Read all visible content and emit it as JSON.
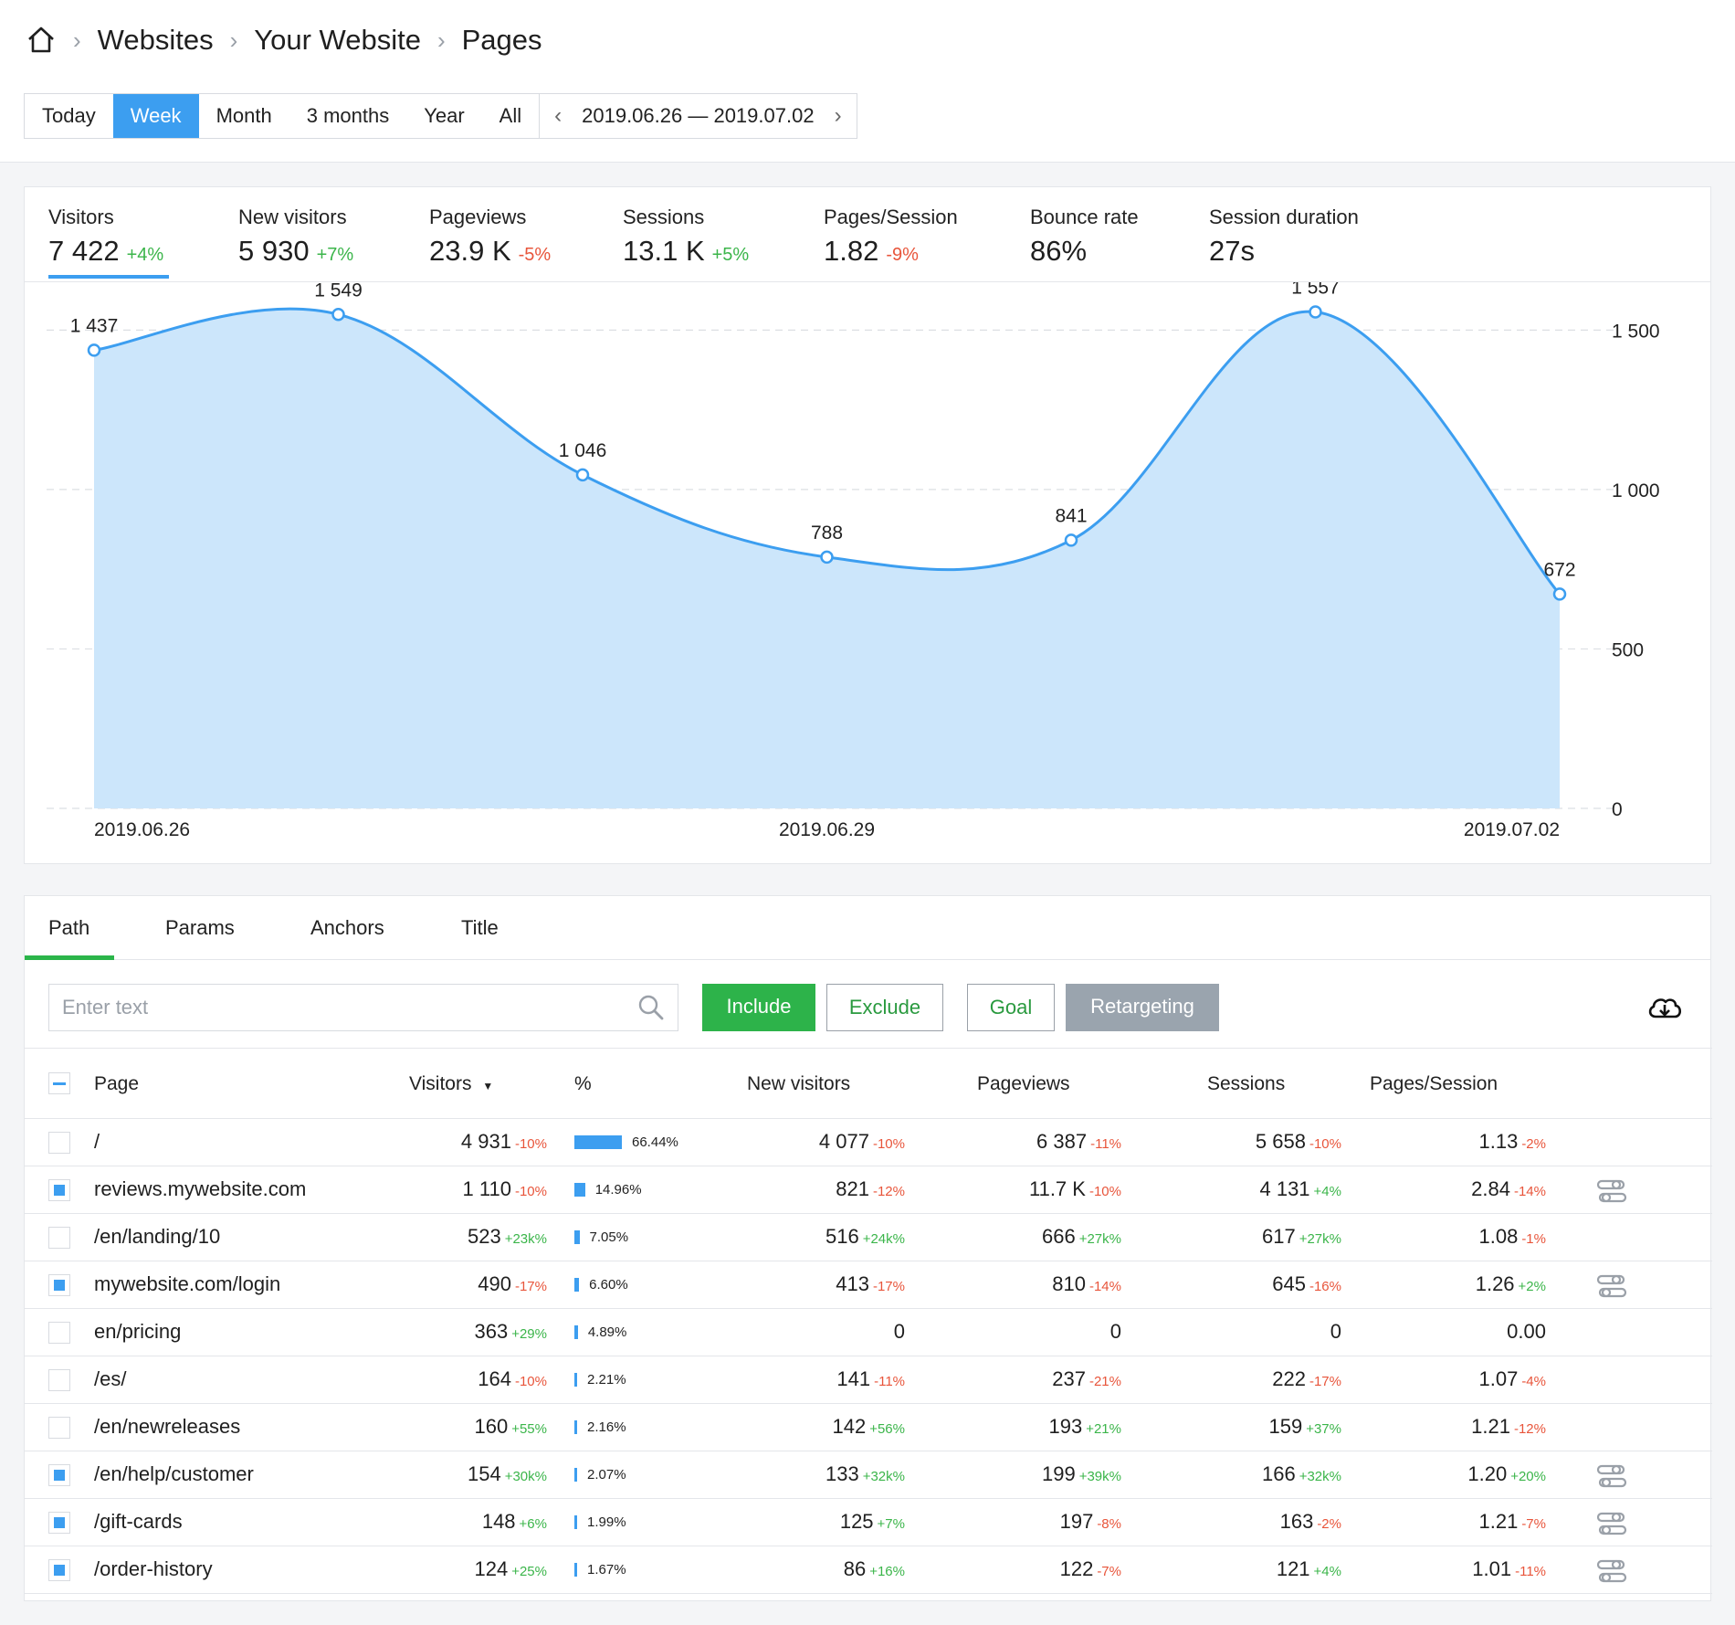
{
  "breadcrumb": {
    "items": [
      "Websites",
      "Your Website",
      "Pages"
    ]
  },
  "period": {
    "buttons": [
      "Today",
      "Week",
      "Month",
      "3 months",
      "Year",
      "All"
    ],
    "active": "Week",
    "range": "2019.06.26 — 2019.07.02"
  },
  "metrics": [
    {
      "label": "Visitors",
      "value": "7 422",
      "change": "+4%",
      "dir": "up"
    },
    {
      "label": "New visitors",
      "value": "5 930",
      "change": "+7%",
      "dir": "up"
    },
    {
      "label": "Pageviews",
      "value": "23.9 K",
      "change": "-5%",
      "dir": "down"
    },
    {
      "label": "Sessions",
      "value": "13.1 K",
      "change": "+5%",
      "dir": "up"
    },
    {
      "label": "Pages/Session",
      "value": "1.82",
      "change": "-9%",
      "dir": "down"
    },
    {
      "label": "Bounce rate",
      "value": "86%",
      "change": "",
      "dir": ""
    },
    {
      "label": "Session duration",
      "value": "27s",
      "change": "",
      "dir": ""
    }
  ],
  "chart_data": {
    "type": "area",
    "x": [
      "2019.06.26",
      "2019.06.27",
      "2019.06.28",
      "2019.06.29",
      "2019.06.30",
      "2019.07.01",
      "2019.07.02"
    ],
    "series": [
      {
        "values": [
          1437,
          1549,
          1046,
          788,
          841,
          1557,
          672
        ]
      }
    ],
    "data_labels": [
      "1 437",
      "1 549",
      "1 046",
      "788",
      "841",
      "1 557",
      "672"
    ],
    "x_tick_labels": [
      "2019.06.26",
      "2019.06.29",
      "2019.07.02"
    ],
    "y_ticks": [
      0,
      500,
      1000,
      1500
    ],
    "y_tick_labels": [
      "0",
      "500",
      "1 000",
      "1 500"
    ],
    "ylim": [
      0,
      1650
    ],
    "grid": true,
    "colors": {
      "line": "#3c9ef0",
      "fill": "#cce6fb"
    }
  },
  "tabs": [
    "Path",
    "Params",
    "Anchors",
    "Title"
  ],
  "filters": {
    "placeholder": "Enter text",
    "include": "Include",
    "exclude": "Exclude",
    "goal": "Goal",
    "retargeting": "Retargeting"
  },
  "table": {
    "headers": [
      "Page",
      "Visitors",
      "%",
      "New visitors",
      "Pageviews",
      "Sessions",
      "Pages/Session"
    ],
    "rows": [
      {
        "checked": false,
        "page": "/",
        "visitors": "4 931",
        "vc": "-10%",
        "vd": "down",
        "pct": 66.44,
        "pct_label": "66.44%",
        "nv": "4 077",
        "nvc": "-10%",
        "nvd": "down",
        "pv": "6 387",
        "pvc": "-11%",
        "pvd": "down",
        "s": "5 658",
        "sc": "-10%",
        "sd": "down",
        "ps": "1.13",
        "psc": "-2%",
        "psd": "down",
        "icon": false
      },
      {
        "checked": true,
        "page": "reviews.mywebsite.com",
        "visitors": "1 110",
        "vc": "-10%",
        "vd": "down",
        "pct": 14.96,
        "pct_label": "14.96%",
        "nv": "821",
        "nvc": "-12%",
        "nvd": "down",
        "pv": "11.7 K",
        "pvc": "-10%",
        "pvd": "down",
        "s": "4 131",
        "sc": "+4%",
        "sd": "up",
        "ps": "2.84",
        "psc": "-14%",
        "psd": "down",
        "icon": true
      },
      {
        "checked": false,
        "page": "/en/landing/10",
        "visitors": "523",
        "vc": "+23k%",
        "vd": "up",
        "pct": 7.05,
        "pct_label": "7.05%",
        "nv": "516",
        "nvc": "+24k%",
        "nvd": "up",
        "pv": "666",
        "pvc": "+27k%",
        "pvd": "up",
        "s": "617",
        "sc": "+27k%",
        "sd": "up",
        "ps": "1.08",
        "psc": "-1%",
        "psd": "down",
        "icon": false
      },
      {
        "checked": true,
        "page": "mywebsite.com/login",
        "visitors": "490",
        "vc": "-17%",
        "vd": "down",
        "pct": 6.6,
        "pct_label": "6.60%",
        "nv": "413",
        "nvc": "-17%",
        "nvd": "down",
        "pv": "810",
        "pvc": "-14%",
        "pvd": "down",
        "s": "645",
        "sc": "-16%",
        "sd": "down",
        "ps": "1.26",
        "psc": "+2%",
        "psd": "up",
        "icon": true
      },
      {
        "checked": false,
        "page": "en/pricing",
        "visitors": "363",
        "vc": "+29%",
        "vd": "up",
        "pct": 4.89,
        "pct_label": "4.89%",
        "nv": "0",
        "nvc": "",
        "nvd": "",
        "pv": "0",
        "pvc": "",
        "pvd": "",
        "s": "0",
        "sc": "",
        "sd": "",
        "ps": "0.00",
        "psc": "",
        "psd": "",
        "icon": false
      },
      {
        "checked": false,
        "page": "/es/",
        "visitors": "164",
        "vc": "-10%",
        "vd": "down",
        "pct": 2.21,
        "pct_label": "2.21%",
        "nv": "141",
        "nvc": "-11%",
        "nvd": "down",
        "pv": "237",
        "pvc": "-21%",
        "pvd": "down",
        "s": "222",
        "sc": "-17%",
        "sd": "down",
        "ps": "1.07",
        "psc": "-4%",
        "psd": "down",
        "icon": false
      },
      {
        "checked": false,
        "page": "/en/newreleases",
        "visitors": "160",
        "vc": "+55%",
        "vd": "up",
        "pct": 2.16,
        "pct_label": "2.16%",
        "nv": "142",
        "nvc": "+56%",
        "nvd": "up",
        "pv": "193",
        "pvc": "+21%",
        "pvd": "up",
        "s": "159",
        "sc": "+37%",
        "sd": "up",
        "ps": "1.21",
        "psc": "-12%",
        "psd": "down",
        "icon": false
      },
      {
        "checked": true,
        "page": "/en/help/customer",
        "visitors": "154",
        "vc": "+30k%",
        "vd": "up",
        "pct": 2.07,
        "pct_label": "2.07%",
        "nv": "133",
        "nvc": "+32k%",
        "nvd": "up",
        "pv": "199",
        "pvc": "+39k%",
        "pvd": "up",
        "s": "166",
        "sc": "+32k%",
        "sd": "up",
        "ps": "1.20",
        "psc": "+20%",
        "psd": "up",
        "icon": true
      },
      {
        "checked": true,
        "page": "/gift-cards",
        "visitors": "148",
        "vc": "+6%",
        "vd": "up",
        "pct": 1.99,
        "pct_label": "1.99%",
        "nv": "125",
        "nvc": "+7%",
        "nvd": "up",
        "pv": "197",
        "pvc": "-8%",
        "pvd": "down",
        "s": "163",
        "sc": "-2%",
        "sd": "down",
        "ps": "1.21",
        "psc": "-7%",
        "psd": "down",
        "icon": true
      },
      {
        "checked": true,
        "page": "/order-history",
        "visitors": "124",
        "vc": "+25%",
        "vd": "up",
        "pct": 1.67,
        "pct_label": "1.67%",
        "nv": "86",
        "nvc": "+16%",
        "nvd": "up",
        "pv": "122",
        "pvc": "-7%",
        "pvd": "down",
        "s": "121",
        "sc": "+4%",
        "sd": "up",
        "ps": "1.01",
        "psc": "-11%",
        "psd": "down",
        "icon": true
      }
    ]
  }
}
